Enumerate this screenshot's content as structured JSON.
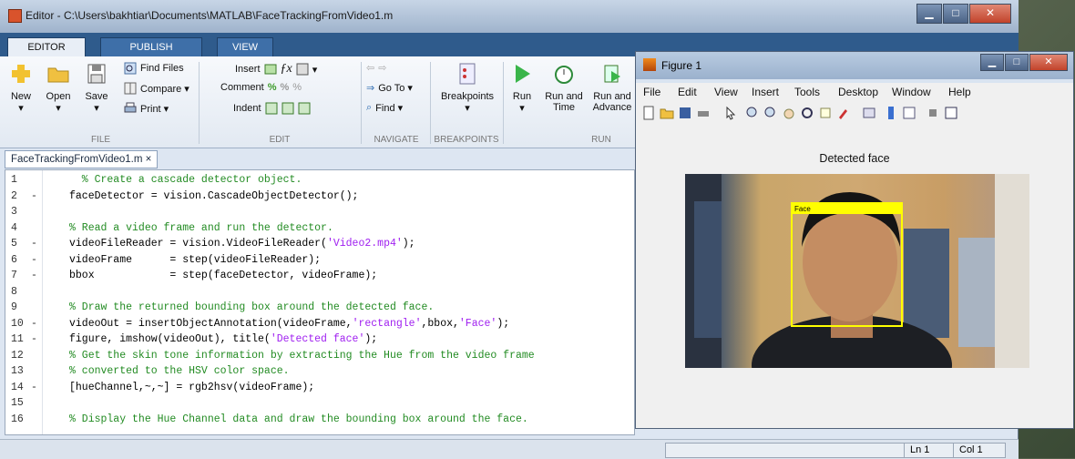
{
  "editor_window": {
    "title": "Editor - C:\\Users\\bakhtiar\\Documents\\MATLAB\\FaceTrackingFromVideo1.m",
    "caption_buttons": [
      "▁",
      "□",
      "✕"
    ]
  },
  "tabs": [
    {
      "label": "EDITOR",
      "active": true
    },
    {
      "label": "PUBLISH",
      "active": false
    },
    {
      "label": "VIEW",
      "active": false
    }
  ],
  "ribbon": {
    "file": {
      "new": "New",
      "open": "Open",
      "save": "Save",
      "find_files": "Find Files",
      "compare": "Compare ▾",
      "print": "Print ▾",
      "section": "FILE"
    },
    "edit": {
      "insert": "Insert",
      "comment": "Comment",
      "indent": "Indent",
      "section": "EDIT"
    },
    "navigate": {
      "goto": "Go To ▾",
      "find": "Find ▾",
      "section": "NAVIGATE"
    },
    "breakpoints": {
      "label": "Breakpoints",
      "section": "BREAKPOINTS"
    },
    "run": {
      "run": "Run",
      "run_and_time_1": "Run and",
      "run_and_time_2": "Time",
      "run_and_advance_1": "Run and",
      "run_and_advance_2": "Advance",
      "section": "RUN"
    }
  },
  "file_tab": "FaceTrackingFromVideo1.m ×",
  "code_lines": [
    {
      "n": "1",
      "dash": "",
      "cls": "cm",
      "text": "  % Create a cascade detector object."
    },
    {
      "n": "2",
      "dash": "-",
      "cls": "",
      "text": "faceDetector = vision.CascadeObjectDetector();"
    },
    {
      "n": "3",
      "dash": "",
      "cls": "",
      "text": ""
    },
    {
      "n": "4",
      "dash": "",
      "cls": "cm",
      "text": "% Read a video frame and run the detector."
    },
    {
      "n": "5",
      "dash": "-",
      "cls": "",
      "text": "videoFileReader = vision.VideoFileReader('Video2.mp4');"
    },
    {
      "n": "6",
      "dash": "-",
      "cls": "",
      "text": "videoFrame      = step(videoFileReader);"
    },
    {
      "n": "7",
      "dash": "-",
      "cls": "",
      "text": "bbox            = step(faceDetector, videoFrame);"
    },
    {
      "n": "8",
      "dash": "",
      "cls": "",
      "text": ""
    },
    {
      "n": "9",
      "dash": "",
      "cls": "cm",
      "text": "% Draw the returned bounding box around the detected face."
    },
    {
      "n": "10",
      "dash": "-",
      "cls": "",
      "text": "videoOut = insertObjectAnnotation(videoFrame,'rectangle',bbox,'Face');"
    },
    {
      "n": "11",
      "dash": "-",
      "cls": "",
      "text": "figure, imshow(videoOut), title('Detected face');"
    },
    {
      "n": "12",
      "dash": "",
      "cls": "cm",
      "text": "% Get the skin tone information by extracting the Hue from the video frame"
    },
    {
      "n": "13",
      "dash": "",
      "cls": "cm",
      "text": "% converted to the HSV color space."
    },
    {
      "n": "14",
      "dash": "-",
      "cls": "",
      "text": "[hueChannel,~,~] = rgb2hsv(videoFrame);"
    },
    {
      "n": "15",
      "dash": "",
      "cls": "",
      "text": ""
    },
    {
      "n": "16",
      "dash": "",
      "cls": "cm",
      "text": "% Display the Hue Channel data and draw the bounding box around the face."
    }
  ],
  "status": {
    "ln": "Ln  1",
    "col": "Col  1"
  },
  "figure": {
    "title": "Figure 1",
    "menu": [
      "File",
      "Edit",
      "View",
      "Insert",
      "Tools",
      "Desktop",
      "Window",
      "Help"
    ],
    "axes_title": "Detected face",
    "annotation_label": "Face"
  },
  "colors": {
    "ribbon_tab_bar": "#2f5b8c",
    "comment": "#228b22",
    "string": "#a020f0",
    "bbox": "#ffff00"
  }
}
